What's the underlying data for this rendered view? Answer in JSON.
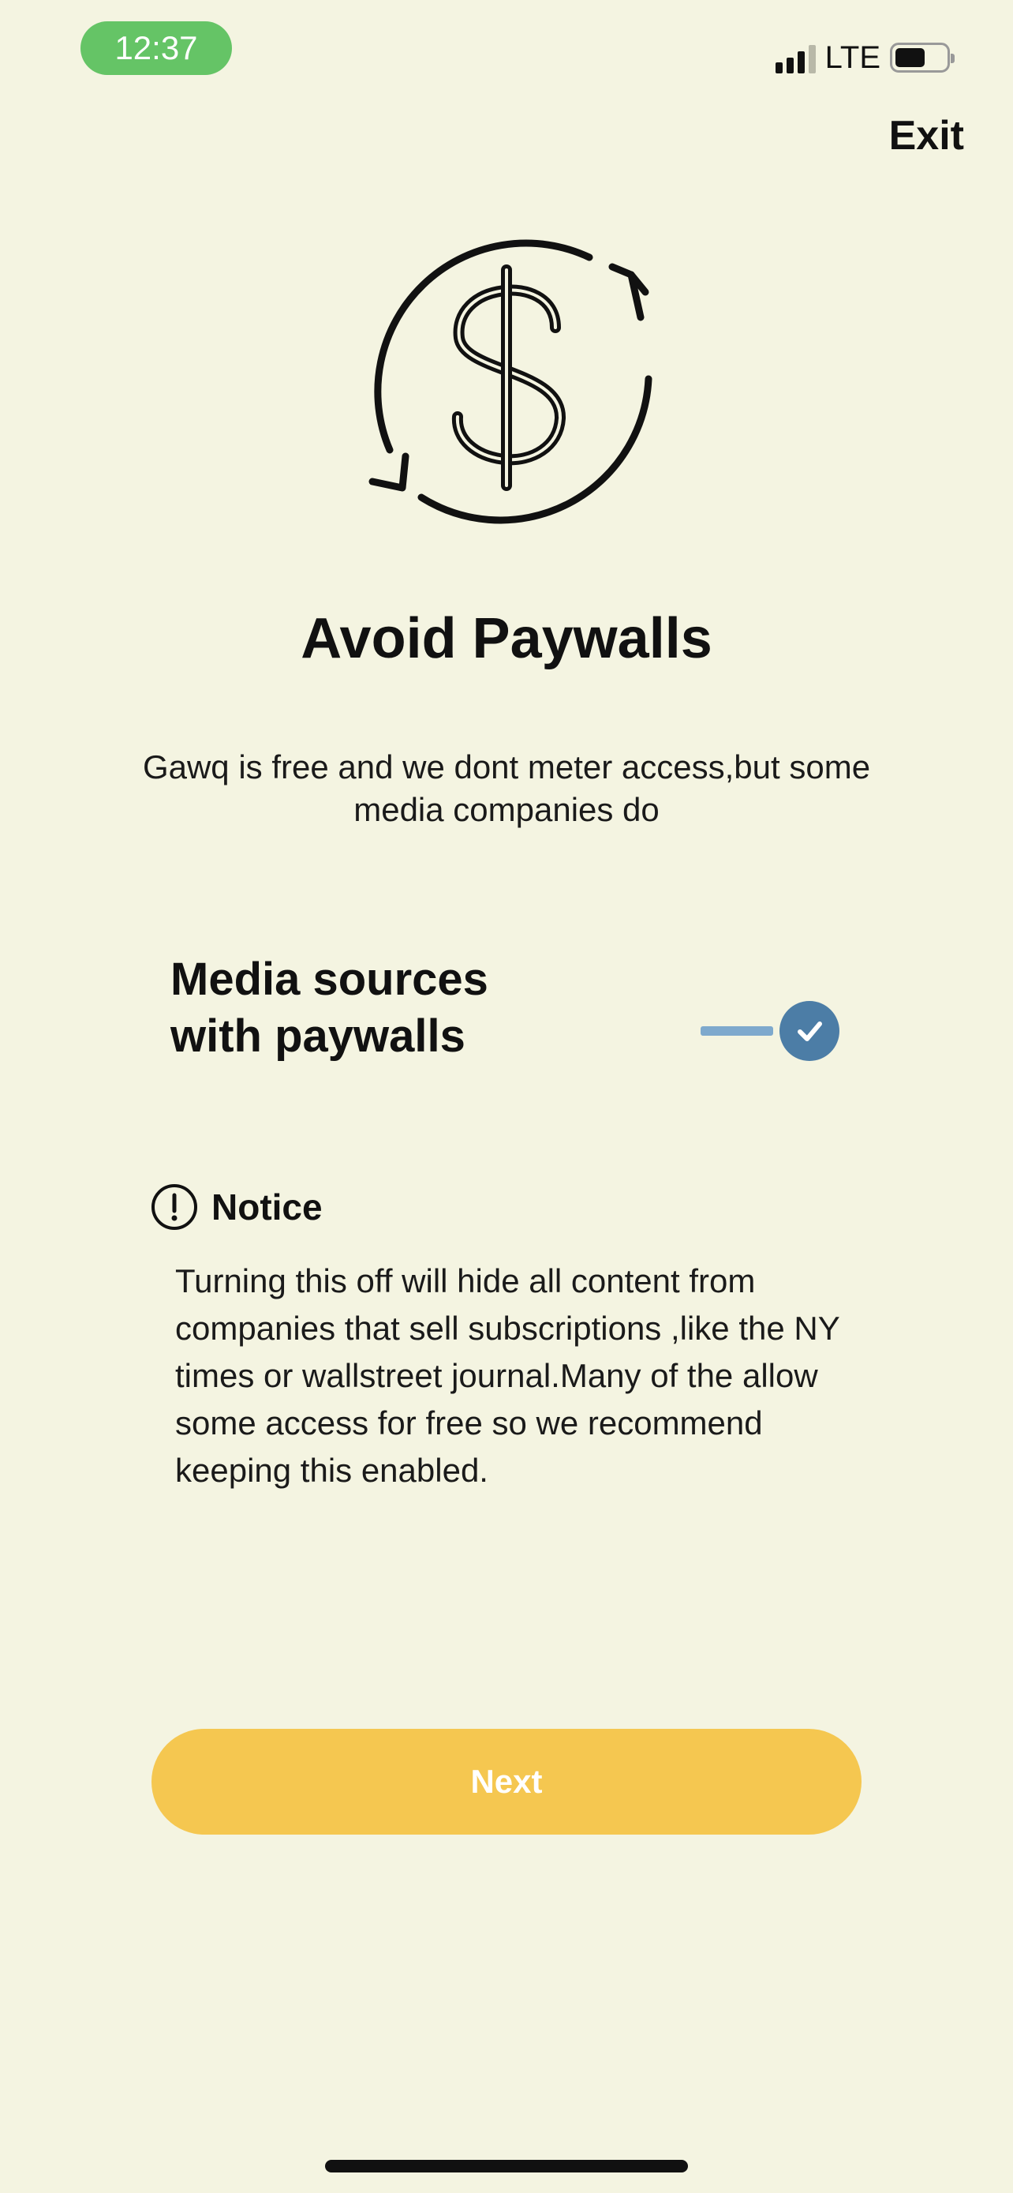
{
  "status_bar": {
    "time": "12:37",
    "network": "LTE",
    "time_pill_color": "#65c466"
  },
  "header": {
    "exit_label": "Exit"
  },
  "hero": {
    "icon": "dollar-refresh-icon",
    "title": "Avoid Paywalls",
    "subtitle": "Gawq is free and we dont meter access,but some media companies do"
  },
  "setting": {
    "label_line1": "Media sources",
    "label_line2": "with paywalls",
    "enabled": true,
    "accent": "#4c7da6"
  },
  "notice": {
    "icon": "exclamation-circle-icon",
    "title": "Notice",
    "body": "Turning this off will hide all content from companies that sell subscriptions ,like the NY times or wallstreet journal.Many of the allow some access for free so we recommend keeping this enabled."
  },
  "footer": {
    "next_label": "Next",
    "button_color": "#f5c750"
  }
}
